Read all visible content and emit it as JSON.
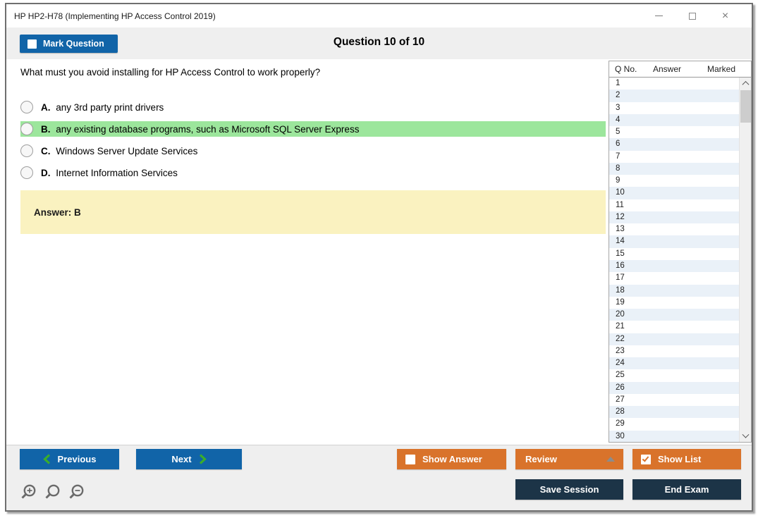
{
  "window": {
    "title": "HP HP2-H78 (Implementing HP Access Control 2019)",
    "controls": {
      "minimize": "minimize-icon",
      "maximize": "maximize-icon",
      "close": "close-icon"
    }
  },
  "header": {
    "mark_question_label": "Mark Question",
    "mark_question_checked": false,
    "question_counter": "Question 10 of 10"
  },
  "question": {
    "text": "What must you avoid installing for HP Access Control to work properly?",
    "options": [
      {
        "letter": "A.",
        "text": "any 3rd party print drivers",
        "highlighted": false
      },
      {
        "letter": "B.",
        "text": "any existing database programs, such as Microsoft SQL Server Express",
        "highlighted": true
      },
      {
        "letter": "C.",
        "text": "Windows Server Update Services",
        "highlighted": false
      },
      {
        "letter": "D.",
        "text": "Internet Information Services",
        "highlighted": false
      }
    ],
    "answer_label": "Answer: B"
  },
  "question_list": {
    "headers": {
      "q_no": "Q No.",
      "answer": "Answer",
      "marked": "Marked"
    },
    "rows": [
      "1",
      "2",
      "3",
      "4",
      "5",
      "6",
      "7",
      "8",
      "9",
      "10",
      "11",
      "12",
      "13",
      "14",
      "15",
      "16",
      "17",
      "18",
      "19",
      "20",
      "21",
      "22",
      "23",
      "24",
      "25",
      "26",
      "27",
      "28",
      "29",
      "30"
    ],
    "answers_column_empty": "",
    "marked_column_empty": ""
  },
  "footer": {
    "previous_label": "Previous",
    "next_label": "Next",
    "show_answer_label": "Show Answer",
    "show_answer_checked": false,
    "review_label": "Review",
    "show_list_label": "Show List",
    "show_list_checked": true,
    "save_session_label": "Save Session",
    "end_exam_label": "End Exam"
  },
  "icons": {
    "previous_chevron": "chevron-left-icon",
    "next_chevron": "chevron-right-icon",
    "review_dropdown": "triangle-up-icon",
    "zoom": [
      "zoom-in-icon",
      "zoom-icon",
      "zoom-out-icon"
    ],
    "scrollbar": [
      "scroll-up-icon",
      "scroll-down-icon"
    ]
  },
  "colors": {
    "accent_blue": "#1164a8",
    "accent_orange": "#d9732b",
    "accent_navy": "#1c3447",
    "highlight_green": "#9ce69c",
    "answer_yellow": "#faf2c0",
    "row_stripe_blue": "#eaf1f8",
    "chevron_green": "#3bae2a",
    "bar_gray": "#efefef"
  }
}
